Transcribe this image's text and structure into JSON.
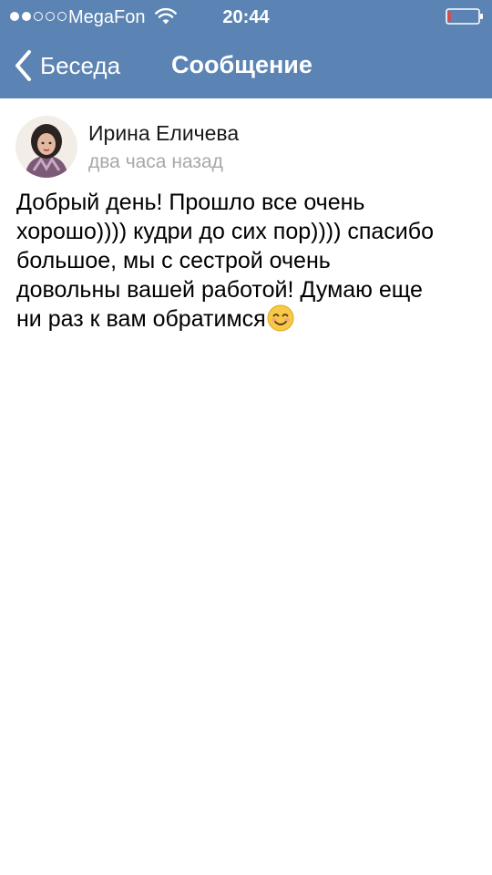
{
  "status_bar": {
    "signal_strength": 2,
    "signal_max": 5,
    "carrier": "MegaFon",
    "wifi_icon": "wifi-icon",
    "time": "20:44",
    "battery_icon": "battery-low-icon",
    "battery_level": 0.08,
    "battery_color": "#ff3b30"
  },
  "nav": {
    "back_icon": "chevron-left-icon",
    "back_label": "Беседа",
    "title": "Сообщение"
  },
  "message": {
    "author": "Ирина Еличева",
    "time": "два часа назад",
    "text": "Добрый день! Прошло все очень\nхорошо)))) кудри до сих пор)))) спасибо\nбольшое, мы с сестрой очень\nдовольны вашей работой! Думаю еще\nни раз к вам обратимся",
    "emoji_icon": "smiling-face-icon"
  },
  "colors": {
    "header_bg": "#5b84b4",
    "header_text": "#ffffff",
    "secondary_text": "#a8a8a8"
  }
}
